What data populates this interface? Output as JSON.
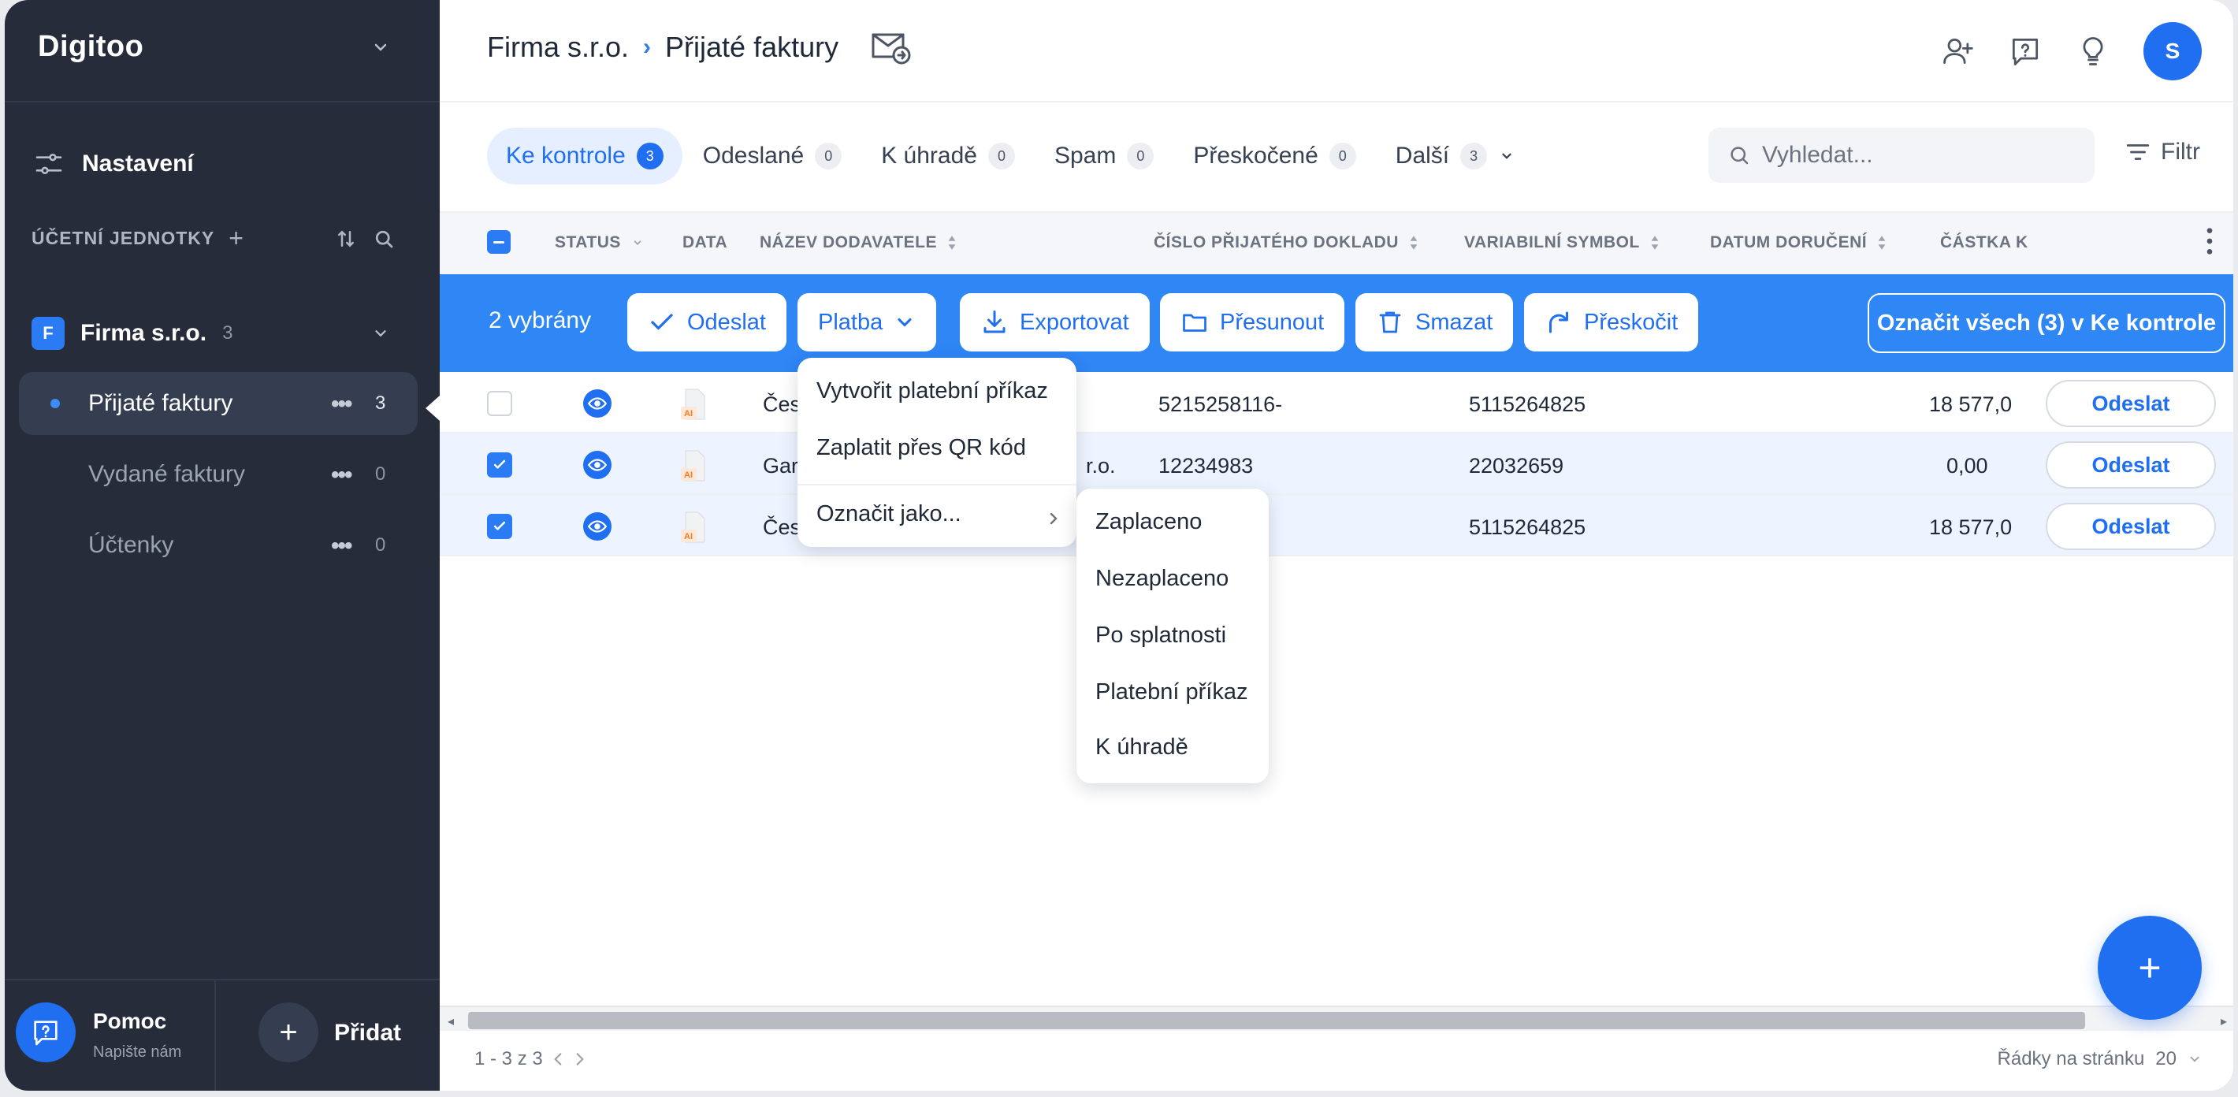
{
  "sidebar": {
    "logo": "Digitoo",
    "settings": "Nastavení",
    "section_label": "ÚČETNÍ JEDNOTKY",
    "company": {
      "badge": "F",
      "name": "Firma s.r.o.",
      "count": "3"
    },
    "items": [
      {
        "label": "Přijaté faktury",
        "count": "3"
      },
      {
        "label": "Vydané faktury",
        "count": "0"
      },
      {
        "label": "Účtenky",
        "count": "0"
      }
    ],
    "help": {
      "title": "Pomoc",
      "sub": "Napište nám"
    },
    "add_label": "Přidat"
  },
  "header": {
    "company": "Firma s.r.o.",
    "page": "Přijaté faktury",
    "avatar": "S"
  },
  "tabs": [
    {
      "label": "Ke kontrole",
      "count": "3"
    },
    {
      "label": "Odeslané",
      "count": "0"
    },
    {
      "label": "K úhradě",
      "count": "0"
    },
    {
      "label": "Spam",
      "count": "0"
    },
    {
      "label": "Přeskočené",
      "count": "0"
    },
    {
      "label": "Další",
      "count": "3"
    }
  ],
  "search": {
    "placeholder": "Vyhledat..."
  },
  "filter_label": "Filtr",
  "columns": [
    "STATUS",
    "DATA",
    "NÁZEV DODAVATELE",
    "ČÍSLO PŘIJATÉHO DOKLADU",
    "VARIABILNÍ SYMBOL",
    "DATUM DORUČENÍ",
    "ČÁSTKA K"
  ],
  "actionbar": {
    "selected": "2 vybrány",
    "send": "Odeslat",
    "payment": "Platba",
    "export": "Exportovat",
    "move": "Přesunout",
    "delete": "Smazat",
    "skip": "Přeskočit",
    "mark_all": "Označit všech (3) v Ke kontrole"
  },
  "rows": [
    {
      "supplier": "Čes",
      "doc_number": "5215258116-",
      "vs": "5115264825",
      "amount": "18 577,0",
      "action": "Odeslat",
      "selected": false
    },
    {
      "supplier": "Gar",
      "supplier_tail": "r.o.",
      "doc_number": "12234983",
      "vs": "22032659",
      "amount": "0,00",
      "action": "Odeslat",
      "selected": true
    },
    {
      "supplier": "Čes",
      "doc_number": "",
      "vs": "5115264825",
      "amount": "18 577,0",
      "action": "Odeslat",
      "selected": true
    }
  ],
  "doc_badge": "AI",
  "payment_menu": {
    "items": [
      "Vytvořit platební příkaz",
      "Zaplatit přes QR kód",
      "Označit jako..."
    ]
  },
  "mark_as_menu": {
    "items": [
      "Zaplaceno",
      "Nezaplaceno",
      "Po splatnosti",
      "Platební příkaz",
      "K úhradě"
    ]
  },
  "pagination": {
    "info": "1 - 3 z 3"
  },
  "rows_per_page": {
    "label": "Řádky na stránku",
    "value": "20"
  },
  "fab": "+",
  "colors": {
    "accent": "#1f6ff0",
    "actionbar": "#2f86f5",
    "sidebar": "#262c3a"
  }
}
